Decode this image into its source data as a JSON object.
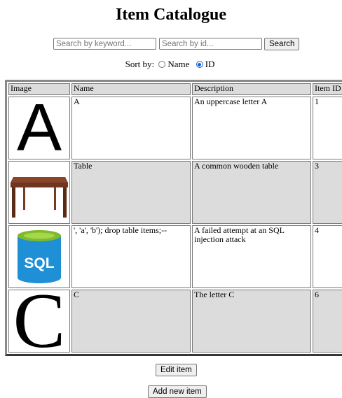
{
  "page": {
    "title": "Item Catalogue"
  },
  "search": {
    "keyword_placeholder": "Search by keyword...",
    "keyword_value": "",
    "id_placeholder": "Search by id...",
    "id_value": "",
    "button_label": "Search"
  },
  "sort": {
    "label": "Sort by:",
    "options": [
      {
        "label": "Name",
        "selected": false
      },
      {
        "label": "ID",
        "selected": true
      }
    ]
  },
  "table": {
    "headers": [
      "Image",
      "Name",
      "Description",
      "Item ID"
    ],
    "rows": [
      {
        "image": "letter-a-image",
        "name": "A",
        "description": "An uppercase letter A",
        "id": "1"
      },
      {
        "image": "wooden-table-image",
        "name": "Table",
        "description": "A common wooden table",
        "id": "3"
      },
      {
        "image": "sql-database-image",
        "name": "', 'a', 'b'); drop table items;--",
        "description": "A failed attempt at an SQL injection attack",
        "id": "4"
      },
      {
        "image": "letter-c-image",
        "name": "C",
        "description": "The letter C",
        "id": "6"
      }
    ],
    "image_text": {
      "sql_logo": "SQL"
    }
  },
  "actions": {
    "edit_label": "Edit item",
    "add_label": "Add new item"
  },
  "colors": {
    "header_bg": "#dcdcdc",
    "sql_blue": "#1f8fd6",
    "sql_green": "#7fba2a",
    "table_wood": "#6e3520"
  }
}
